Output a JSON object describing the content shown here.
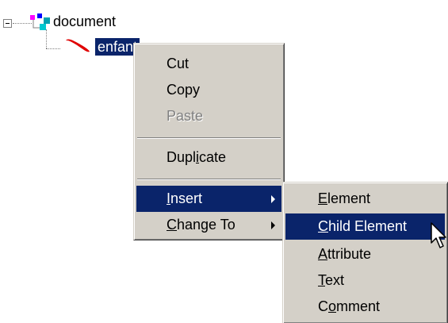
{
  "tree": {
    "root_label": "document",
    "child_label": "enfant"
  },
  "context_menu": {
    "items": [
      {
        "before": "Cut",
        "key": "",
        "after": "",
        "enabled": true
      },
      {
        "before": "Copy",
        "key": "",
        "after": "",
        "enabled": true
      },
      {
        "before": "Paste",
        "key": "",
        "after": "",
        "enabled": false
      },
      {
        "before": "Dupl",
        "key": "i",
        "after": "cate",
        "enabled": true
      },
      {
        "before": "",
        "key": "I",
        "after": "nsert",
        "enabled": true,
        "highlighted": true,
        "submenu": true
      },
      {
        "before": "",
        "key": "C",
        "after": "hange To",
        "enabled": true,
        "submenu": true
      }
    ]
  },
  "insert_submenu": {
    "items": [
      {
        "before": "",
        "key": "E",
        "after": "lement"
      },
      {
        "before": "",
        "key": "C",
        "after": "hild Element",
        "highlighted": true
      },
      {
        "before": "",
        "key": "A",
        "after": "ttribute"
      },
      {
        "before": "",
        "key": "T",
        "after": "ext"
      },
      {
        "before": "C",
        "key": "o",
        "after": "mment"
      }
    ]
  },
  "colors": {
    "menu_background": "#d4d0c8",
    "highlight": "#0a246a",
    "highlight_text": "#ffffff",
    "disabled_text": "#808080"
  },
  "icons": [
    "tree-collapse-icon",
    "document-node-icon",
    "element-node-icon",
    "submenu-arrow-icon",
    "mouse-pointer-icon"
  ]
}
